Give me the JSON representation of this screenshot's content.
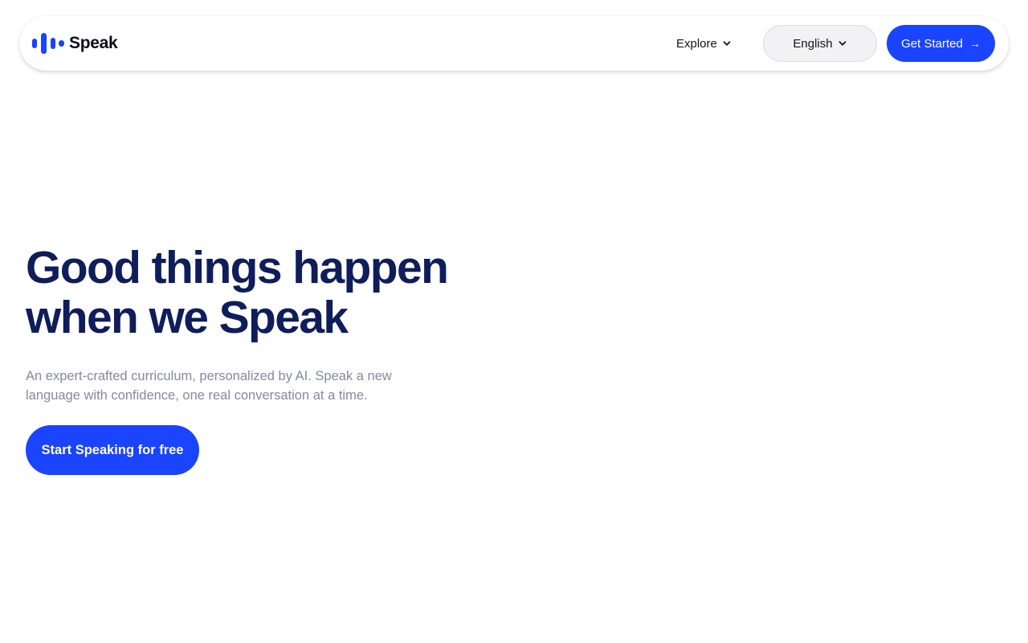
{
  "nav": {
    "logo_text": "Speak",
    "explore_label": "Explore",
    "language_label": "English",
    "cta_label": "Get Started",
    "cta_arrow": "→"
  },
  "hero": {
    "title_line_1": "Good things happen",
    "title_line_2": "when we Speak",
    "subtitle_line_1": "An expert-crafted curriculum, personalized by AI. Speak a new",
    "subtitle_line_2": "language with confidence, one real conversation at a time.",
    "cta_label": "Start Speaking for free"
  },
  "icons": {
    "logo": "speak-waveform-icon",
    "explore_chevron": "chevron-down-icon",
    "language_chevron": "chevron-down-icon",
    "arrow": "arrow-right-icon"
  },
  "colors": {
    "brand_blue": "#1a44ff",
    "title_navy": "#0f1d5a",
    "subtitle_gray": "#848a9e",
    "language_button_bg": "#f2f2f4"
  }
}
